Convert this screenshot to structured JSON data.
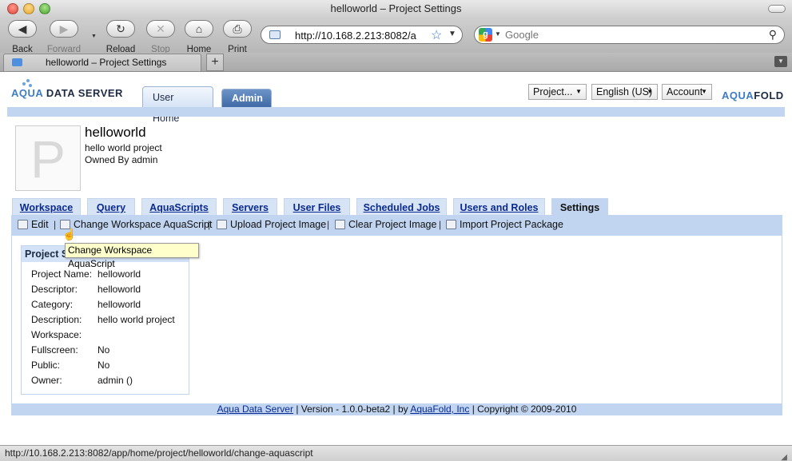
{
  "window": {
    "title": "helloworld – Project Settings"
  },
  "toolbar": {
    "back": "Back",
    "forward": "Forward",
    "reload": "Reload",
    "stop": "Stop",
    "home": "Home",
    "print": "Print",
    "url": "http://10.168.2.213:8082/a",
    "search_placeholder": "Google"
  },
  "browser_tab": {
    "title": "helloworld – Project Settings"
  },
  "header": {
    "logo_left_prefix": "AQUA",
    "logo_left_suffix": " DATA SERVER",
    "logo_right_prefix": "AQUA",
    "logo_right_suffix": "FOLD",
    "user_tabs": [
      "User Home",
      "Admin"
    ],
    "dropdowns": {
      "project": "Project...",
      "language": "English (US)",
      "account": "Account"
    }
  },
  "project": {
    "avatar_letter": "P",
    "name": "helloworld",
    "description": "hello world project",
    "owner_line": "Owned By admin"
  },
  "tabs": [
    "Workspace",
    "Query",
    "AquaScripts",
    "Servers",
    "User Files",
    "Scheduled Jobs",
    "Users and Roles",
    "Settings"
  ],
  "actions": [
    "Edit",
    "Change Workspace AquaScript",
    "Upload Project Image",
    "Clear Project Image",
    "Import Project Package"
  ],
  "tooltip": "Change Workspace AquaScript",
  "settings_panel": {
    "title": "Project S",
    "rows": [
      {
        "key": "Project Name:",
        "value": "helloworld"
      },
      {
        "key": "Descriptor:",
        "value": "helloworld"
      },
      {
        "key": "Category:",
        "value": "helloworld"
      },
      {
        "key": "Description:",
        "value": "hello world project"
      },
      {
        "key": "Workspace:",
        "value": ""
      },
      {
        "key": "Fullscreen:",
        "value": "No"
      },
      {
        "key": "Public:",
        "value": "No"
      },
      {
        "key": "Owner:",
        "value": "admin ()"
      }
    ]
  },
  "footer": {
    "link1": "Aqua Data Server",
    "text1": " | Version - 1.0.0-beta2 | by ",
    "link2": "AquaFold, Inc",
    "text2": " | Copyright © 2009-2010"
  },
  "status": "http://10.168.2.213:8082/app/home/project/helloworld/change-aquascript"
}
